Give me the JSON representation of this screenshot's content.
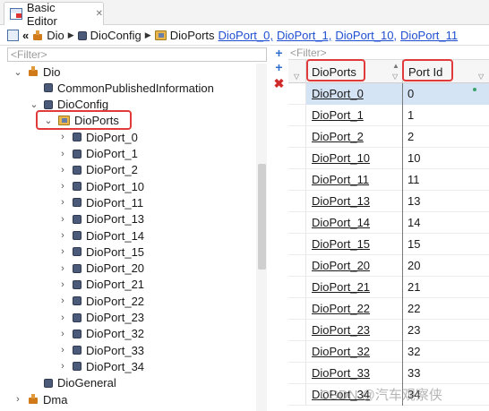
{
  "tab": {
    "title": "Basic Editor",
    "close_glyph": "✕",
    "icon": "editor-icon"
  },
  "breadcrumb": {
    "back_glyph": "«",
    "items": [
      {
        "label": "Dio",
        "icon": "module-icon",
        "link": false
      },
      {
        "label": "DioConfig",
        "icon": "node-icon",
        "link": false
      },
      {
        "label": "DioPorts",
        "icon": "folder-icon",
        "link": false
      }
    ],
    "links": [
      "DioPort_0,",
      "DioPort_1,",
      "DioPort_10,",
      "DioPort_11"
    ]
  },
  "tree": {
    "filter_placeholder": "<Filter>",
    "nodes": [
      {
        "label": "Dio",
        "chevron": "v",
        "icon": "module"
      },
      {
        "label": "CommonPublishedInformation",
        "chevron": "",
        "icon": "node"
      },
      {
        "label": "DioConfig",
        "chevron": "v",
        "icon": "node"
      },
      {
        "label": "DioPorts",
        "chevron": "v",
        "icon": "folder"
      },
      {
        "label": "DioPort_0",
        "chevron": ">",
        "icon": "node"
      },
      {
        "label": "DioPort_1",
        "chevron": ">",
        "icon": "node"
      },
      {
        "label": "DioPort_2",
        "chevron": ">",
        "icon": "node"
      },
      {
        "label": "DioPort_10",
        "chevron": ">",
        "icon": "node"
      },
      {
        "label": "DioPort_11",
        "chevron": ">",
        "icon": "node"
      },
      {
        "label": "DioPort_13",
        "chevron": ">",
        "icon": "node"
      },
      {
        "label": "DioPort_14",
        "chevron": ">",
        "icon": "node"
      },
      {
        "label": "DioPort_15",
        "chevron": ">",
        "icon": "node"
      },
      {
        "label": "DioPort_20",
        "chevron": ">",
        "icon": "node"
      },
      {
        "label": "DioPort_21",
        "chevron": ">",
        "icon": "node"
      },
      {
        "label": "DioPort_22",
        "chevron": ">",
        "icon": "node"
      },
      {
        "label": "DioPort_23",
        "chevron": ">",
        "icon": "node"
      },
      {
        "label": "DioPort_32",
        "chevron": ">",
        "icon": "node"
      },
      {
        "label": "DioPort_33",
        "chevron": ">",
        "icon": "node"
      },
      {
        "label": "DioPort_34",
        "chevron": ">",
        "icon": "node"
      },
      {
        "label": "DioGeneral",
        "chevron": "",
        "icon": "node"
      },
      {
        "label": "Dma",
        "chevron": ">",
        "icon": "module"
      }
    ]
  },
  "actions": {
    "add": "+",
    "add_child": "+",
    "delete": "✖"
  },
  "grid": {
    "filter_placeholder": "<Filter>",
    "columns": [
      "DioPorts",
      "Port Id"
    ],
    "rows": [
      {
        "name": "DioPort_0",
        "id": "0"
      },
      {
        "name": "DioPort_1",
        "id": "1"
      },
      {
        "name": "DioPort_2",
        "id": "2"
      },
      {
        "name": "DioPort_10",
        "id": "10"
      },
      {
        "name": "DioPort_11",
        "id": "11"
      },
      {
        "name": "DioPort_13",
        "id": "13"
      },
      {
        "name": "DioPort_14",
        "id": "14"
      },
      {
        "name": "DioPort_15",
        "id": "15"
      },
      {
        "name": "DioPort_20",
        "id": "20"
      },
      {
        "name": "DioPort_21",
        "id": "21"
      },
      {
        "name": "DioPort_22",
        "id": "22"
      },
      {
        "name": "DioPort_23",
        "id": "23"
      },
      {
        "name": "DioPort_32",
        "id": "32"
      },
      {
        "name": "DioPort_33",
        "id": "33"
      },
      {
        "name": "DioPort_34",
        "id": "34"
      }
    ]
  },
  "watermark": "CSDN @汽车观察侠",
  "colors": {
    "highlight": "#e03a3a",
    "link": "#1f4fd1",
    "selection": "#d5e4f5"
  }
}
